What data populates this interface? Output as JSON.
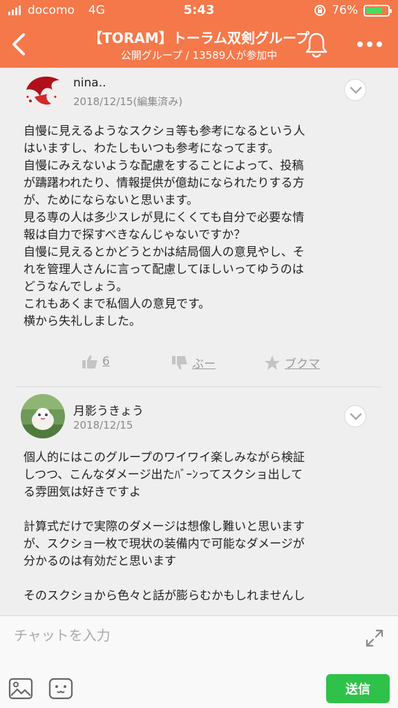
{
  "status_bar": {
    "carrier": "docomo",
    "network": "4G",
    "time": "5:43",
    "battery_percent": "76%",
    "battery_level": 0.76
  },
  "header": {
    "title": "【TORAM】トーラム双剣グループ",
    "subtitle": "公開グループ / 13589人が参加中"
  },
  "posts": [
    {
      "author": "nina..",
      "date": "2018/12/15(編集済み)",
      "lines": [
        "自慢に見えるようなスクショ等も参考になるという人",
        "はいますし、わたしもいつも参考になってます。",
        "自慢にみえないような配慮をすることによって、投稿",
        "が躊躇われたり、情報提供が億劫になられたりする方",
        "が、ためにならないと思います。",
        "見る専の人は多少スレが見にくくても自分で必要な情",
        "報は自力で探すべきなんじゃないですか？",
        "自慢に見えるとかどうとかは結局個人の意見やし、そ",
        "れを管理人さんに言って配慮してほしいってゆうのは",
        "どうなんでしょう。",
        "これもあくまで私個人の意見です。",
        "横から失礼しました。"
      ],
      "like_count": "6",
      "boo_label": "ぶー",
      "bookmark_label": "ブクマ"
    },
    {
      "author": "月影うきょう",
      "date": "2018/12/15",
      "lines": [
        "個人的にはこのグループのワイワイ楽しみながら検証",
        "しつつ、こんなダメージ出たﾊﾞｰﾝってスクショ出して",
        "る雰囲気は好きですよ",
        "",
        "計算式だけで実際のダメージは想像し難いと思います",
        "が、スクショ一枚で現状の装備内で可能なダメージが",
        "分かるのは有効だと思います",
        "",
        "そのスクショから色々と話が膨らむかもしれませんし"
      ]
    }
  ],
  "composer": {
    "placeholder": "チャットを入力",
    "send_label": "送信"
  },
  "icons": {
    "back": "chevron-left-icon",
    "bell": "bell-icon",
    "more": "more-dots-icon",
    "expand": "expand-icon",
    "image": "image-icon",
    "sticker": "sticker-icon",
    "like": "thumbs-up-icon",
    "boo": "thumbs-down-icon",
    "bookmark": "star-icon"
  },
  "colors": {
    "header": "#f5784a",
    "send_button": "#2fc24a",
    "battery": "#4cd964"
  }
}
